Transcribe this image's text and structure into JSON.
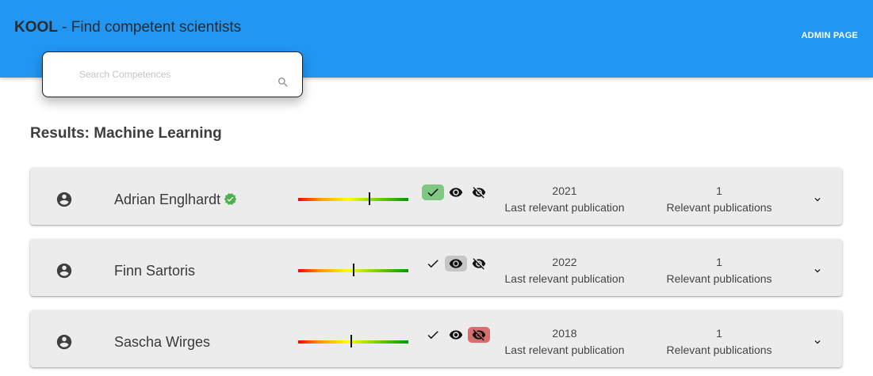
{
  "app": {
    "brand": "KOOL",
    "subtitle": " - Find competent scientists",
    "admin_label": "ADMIN PAGE"
  },
  "search": {
    "placeholder": "Search Competences",
    "value": "",
    "icon": "search-icon"
  },
  "results": {
    "title": "Results: Machine Learning",
    "items": [
      {
        "name": "Adrian Englhardt",
        "verified": true,
        "score": 0.65,
        "status": "approved",
        "year": "2021",
        "year_label": "Last relevant publication",
        "count": "1",
        "count_label": "Relevant publications"
      },
      {
        "name": "Finn Sartoris",
        "verified": false,
        "score": 0.5,
        "status": "viewed",
        "year": "2022",
        "year_label": "Last relevant publication",
        "count": "1",
        "count_label": "Relevant publications"
      },
      {
        "name": "Sascha Wirges",
        "verified": false,
        "score": 0.48,
        "status": "hidden",
        "year": "2018",
        "year_label": "Last relevant publication",
        "count": "1",
        "count_label": "Relevant publications"
      }
    ]
  },
  "colors": {
    "appbar": "#2196f3",
    "approve_active": "#80c783",
    "view_active": "#c6c6c6",
    "hide_active": "#d86f6f",
    "verified": "#4caf50"
  },
  "icons": {
    "avatar": "account-circle-icon",
    "verified": "verified-badge-icon",
    "approve": "check-icon",
    "view": "eye-icon",
    "hide": "eye-off-icon",
    "expand": "chevron-down-icon"
  }
}
